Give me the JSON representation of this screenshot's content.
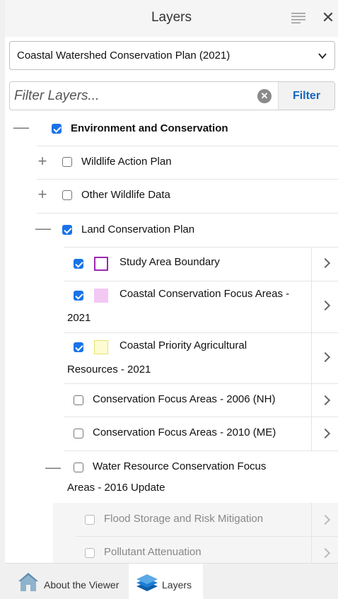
{
  "header": {
    "title": "Layers",
    "menu_icon": "list-icon",
    "close_icon": "close-icon",
    "close_glyph": "✕"
  },
  "map_select": {
    "value": "Coastal Watershed Conservation Plan (2021)"
  },
  "filter": {
    "placeholder": "Filter Layers...",
    "clear_glyph": "✕",
    "button_label": "Filter"
  },
  "tree": {
    "environment": {
      "label": "Environment and Conservation",
      "checked": true,
      "expanded": true
    },
    "wildlife_action_plan": {
      "label": "Wildlife Action Plan",
      "checked": false,
      "expanded": false
    },
    "other_wildlife_data": {
      "label": "Other Wildlife Data",
      "checked": false,
      "expanded": false
    },
    "land_conservation_plan": {
      "label": "Land Conservation Plan",
      "checked": true,
      "expanded": true
    },
    "study_area_boundary": {
      "label": "Study Area Boundary",
      "checked": true,
      "swatch": "#9c27b0"
    },
    "coastal_focus_2021": {
      "label_line1": "Coastal Conservation Focus Areas -",
      "label_line2": "2021",
      "checked": true,
      "swatch": "#f3c8f3"
    },
    "coastal_ag_2021": {
      "label_line1": "Coastal Priority Agricultural",
      "label_line2": "Resources - 2021",
      "checked": true,
      "swatch": "#f7f59a"
    },
    "focus_2006": {
      "label": "Conservation Focus Areas - 2006 (NH)",
      "checked": false
    },
    "focus_2010": {
      "label": "Conservation Focus Areas - 2010 (ME)",
      "checked": false
    },
    "water_resource": {
      "label_line1": "Water Resource Conservation Focus",
      "label_line2": "Areas - 2016 Update",
      "checked": false,
      "expanded": true
    },
    "flood_storage": {
      "label": "Flood Storage and Risk Mitigation",
      "checked": false,
      "disabled": true
    },
    "pollutant": {
      "label": "Pollutant Attenuation",
      "checked": false,
      "disabled": true
    }
  },
  "glyphs": {
    "collapse": "—",
    "expand": "+"
  },
  "tabs": [
    {
      "label": "About the Viewer",
      "icon": "home-icon",
      "active": false
    },
    {
      "label": "Layers",
      "icon": "layers-icon",
      "active": true
    }
  ],
  "colors": {
    "accent": "#1a73e8",
    "filter_button_text": "#1565c0"
  }
}
